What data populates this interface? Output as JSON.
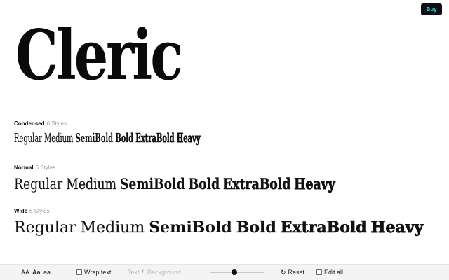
{
  "header": {
    "buy_label": "Buy"
  },
  "hero": {
    "title": "Cleric"
  },
  "families": [
    {
      "name": "Condensed",
      "count": "6 Styles",
      "styles": [
        "Regular",
        "Medium",
        "SemiBold",
        "Bold",
        "ExtraBold",
        "Heavy"
      ]
    },
    {
      "name": "Normal",
      "count": "6 Styles",
      "styles": [
        "Regular",
        "Medium",
        "SemiBold",
        "Bold",
        "ExtraBold",
        "Heavy"
      ]
    },
    {
      "name": "Wide",
      "count": "6 Styles",
      "styles": [
        "Regular",
        "Medium",
        "SemiBold",
        "Bold",
        "ExtraBold",
        "Heavy"
      ]
    }
  ],
  "toolbar": {
    "case_options": [
      "AA",
      "Aa",
      "aa"
    ],
    "wrap_label": "Wrap text",
    "text_placeholder": "Text",
    "separator": "/",
    "background_placeholder": "Background",
    "size_slider": {
      "value": 0.45
    },
    "reset_label": "Reset",
    "edit_all_label": "Edit all"
  },
  "colors": {
    "buy_bg": "#0d1117",
    "buy_text": "#3ee6c8",
    "toolbar_bg": "#f4f4f4"
  },
  "icons": {
    "reset": "reset-icon"
  }
}
